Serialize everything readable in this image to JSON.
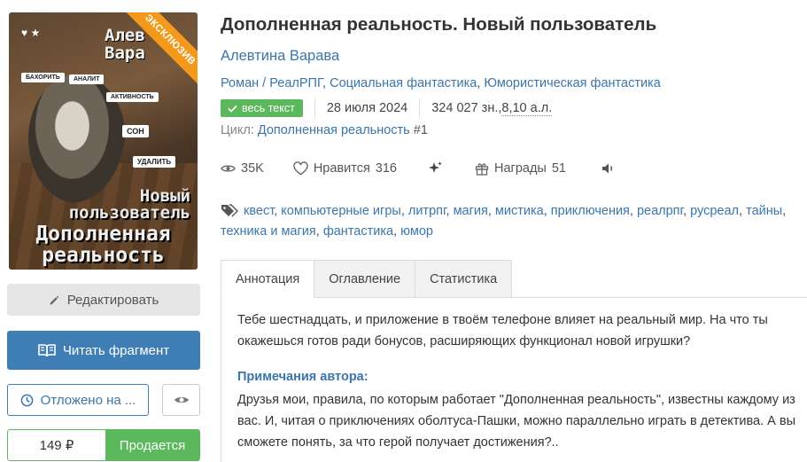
{
  "cover": {
    "ribbon": "ЭКСКЛЮЗИВ",
    "top_title": [
      "Алев",
      "Вара"
    ],
    "chips": [
      "БАХОРИТЬ",
      "АНАЛИТ",
      "АКТИВНОСТЬ",
      "СОН",
      "УДАЛИТЬ"
    ],
    "title_small": [
      "Новый",
      "пользователь"
    ],
    "title_big": [
      "Дополненная",
      "реальность"
    ]
  },
  "actions": {
    "edit_label": "Редактировать",
    "read_label": "Читать фрагмент",
    "later_label": "Отложено на ...",
    "price": "149 ₽",
    "sell_label": "Продается"
  },
  "book": {
    "title": "Дополненная реальность. Новый пользователь",
    "author": "Алевтина Варава",
    "genres": [
      "Роман / РеалРПГ",
      "Социальная фантастика",
      "Юмористическая фантастика"
    ],
    "status_badge": "весь текст",
    "date": "28 июля 2024",
    "size_chars": "324 027 зн., ",
    "size_al": "8,10 а.л.",
    "cycle_label": "Цикл:",
    "cycle_name": "Дополненная реальность",
    "cycle_num": "#1"
  },
  "stats": {
    "views": "35K",
    "likes_label": "Нравится",
    "likes": "316",
    "awards_label": "Награды",
    "awards": "51"
  },
  "tags": [
    "квест",
    "компьютерные игры",
    "литрпг",
    "магия",
    "мистика",
    "приключения",
    "реалрпг",
    "русреал",
    "тайны",
    "техника и магия",
    "фантастика",
    "юмор"
  ],
  "tabs": [
    "Аннотация",
    "Оглавление",
    "Статистика"
  ],
  "annotation": {
    "text": "Тебе шестнадцать, и приложение в твоём телефоне влияет на реальный мир. На что ты окажешься готов ради бонусов, расширяющих функционал новой игрушки?",
    "notes_heading": "Примечания автора:",
    "notes": "Друзья мои, правила, по которым работает \"Дополненная реальность\", известны каж­дому из вас. И, читая о приключениях оболтуса-Пашки, можно параллельно играть в детектива. А вы сможете понять, за что герой получает достижения?.."
  },
  "colors": {
    "accent": "#3f7fb6",
    "green": "#5cb85c",
    "ribbon": "#f39a1c"
  }
}
